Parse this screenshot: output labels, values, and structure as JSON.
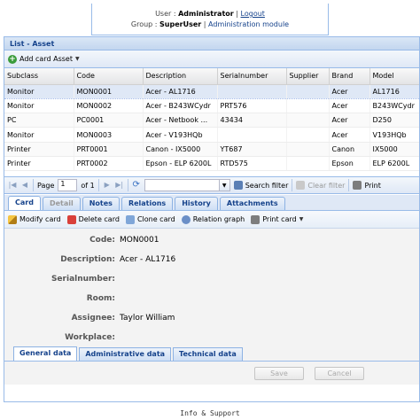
{
  "header": {
    "user_label": "User :",
    "user_name": "Administrator",
    "logout": "Logout",
    "group_label": "Group :",
    "group_name": "SuperUser",
    "admin_module": "Administration module"
  },
  "panel": {
    "title": "List - Asset"
  },
  "toolbar": {
    "add_card": "Add card Asset"
  },
  "grid": {
    "columns": [
      "Subclass",
      "Code",
      "Description",
      "Serialnumber",
      "Supplier",
      "Brand",
      "Model"
    ],
    "rows": [
      [
        "Monitor",
        "MON0001",
        "Acer - AL1716",
        "",
        "",
        "Acer",
        "AL1716"
      ],
      [
        "Monitor",
        "MON0002",
        "Acer - B243WCydr",
        "PRT576",
        "",
        "Acer",
        "B243WCydr"
      ],
      [
        "PC",
        "PC0001",
        "Acer - Netbook ...",
        "43434",
        "",
        "Acer",
        "D250"
      ],
      [
        "Monitor",
        "MON0003",
        "Acer - V193HQb",
        "",
        "",
        "Acer",
        "V193HQb"
      ],
      [
        "Printer",
        "PRT0001",
        "Canon - IX5000",
        "YT687",
        "",
        "Canon",
        "IX5000"
      ],
      [
        "Printer",
        "PRT0002",
        "Epson - ELP 6200L",
        "RTD575",
        "",
        "Epson",
        "ELP 6200L"
      ]
    ]
  },
  "pager": {
    "page_label": "Page",
    "page_value": "1",
    "of_label": "of 1",
    "search_filter": "Search filter",
    "clear_filter": "Clear filter",
    "print": "Print"
  },
  "tabs": [
    "Card",
    "Detail",
    "Notes",
    "Relations",
    "History",
    "Attachments"
  ],
  "card_toolbar": {
    "modify": "Modify card",
    "delete": "Delete card",
    "clone": "Clone card",
    "relation_graph": "Relation graph",
    "print_card": "Print card"
  },
  "form": {
    "fields": [
      {
        "label": "Code:",
        "value": "MON0001"
      },
      {
        "label": "Description:",
        "value": "Acer - AL1716"
      },
      {
        "label": "Serialnumber:",
        "value": ""
      },
      {
        "label": "Room:",
        "value": ""
      },
      {
        "label": "Assignee:",
        "value": "Taylor William"
      },
      {
        "label": "Workplace:",
        "value": ""
      }
    ]
  },
  "bottom_tabs": [
    "General data",
    "Administrative data",
    "Technical data"
  ],
  "buttons": {
    "save": "Save",
    "cancel": "Cancel"
  },
  "footer": {
    "info": "Info & Support"
  },
  "colors": {
    "accent": "#15428b",
    "border": "#99bbe8",
    "selected_row": "#dfe8f6"
  }
}
